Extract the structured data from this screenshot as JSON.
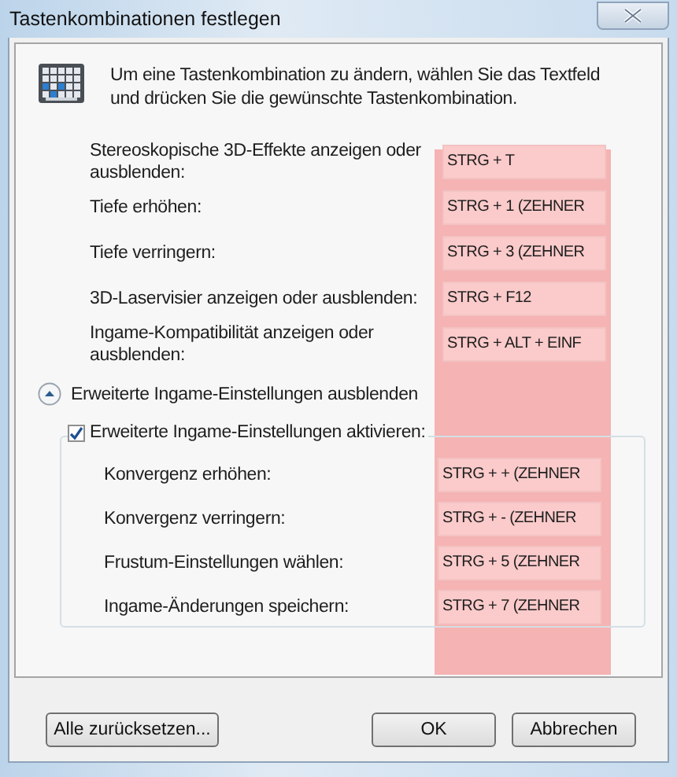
{
  "window": {
    "title": "Tastenkombinationen festlegen"
  },
  "intro": "Um eine Tastenkombination zu ändern, wählen Sie das Textfeld und drücken Sie die gewünschte Tastenkombination.",
  "shortcuts": [
    {
      "label": "Stereoskopische 3D-Effekte anzeigen oder ausblenden:",
      "value": "STRG + T"
    },
    {
      "label": "Tiefe erhöhen:",
      "value": "STRG + 1 (ZEHNER"
    },
    {
      "label": "Tiefe verringern:",
      "value": "STRG + 3 (ZEHNER"
    },
    {
      "label": "3D-Laservisier anzeigen oder ausblenden:",
      "value": "STRG + F12"
    },
    {
      "label": "Ingame-Kompatibilität anzeigen oder ausblenden:",
      "value": "STRG + ALT + EINF"
    }
  ],
  "advanced_toggle": {
    "label": "Erweiterte Ingame-Einstellungen ausblenden",
    "expanded": true
  },
  "advanced": {
    "label": "Erweiterte Ingame-Einstellungen aktivieren:",
    "checked": true,
    "shortcuts": [
      {
        "label": "Konvergenz erhöhen:",
        "value": "STRG + + (ZEHNER"
      },
      {
        "label": "Konvergenz verringern:",
        "value": "STRG + - (ZEHNER"
      },
      {
        "label": "Frustum-Einstellungen wählen:",
        "value": "STRG + 5 (ZEHNER"
      },
      {
        "label": "Ingame-Änderungen speichern:",
        "value": "STRG + 7 (ZEHNER"
      }
    ]
  },
  "buttons": [
    "Alle zurücksetzen...",
    "OK",
    "Abbrechen"
  ]
}
